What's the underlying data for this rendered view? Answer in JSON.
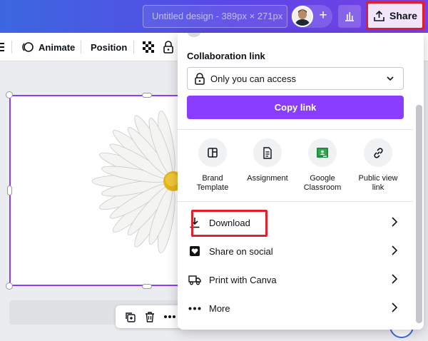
{
  "header": {
    "design_title": "Untitled design - 389px × 271px",
    "add_collaborator_symbol": "+",
    "share_label": "Share",
    "stats_icon": "bar-chart-icon",
    "share_icon": "upload-icon"
  },
  "toolbar": {
    "animate_label": "Animate",
    "position_label": "Position"
  },
  "share_panel": {
    "collaboration_label": "Collaboration link",
    "access_value": "Only you can access",
    "copy_link_label": "Copy link",
    "options": [
      {
        "label": "Brand Template",
        "icon": "brand-template-icon"
      },
      {
        "label": "Assignment",
        "icon": "document-icon"
      },
      {
        "label": "Google Classroom",
        "icon": "google-classroom-icon"
      },
      {
        "label": "Public view link",
        "icon": "link-icon"
      }
    ],
    "menu": [
      {
        "label": "Download",
        "icon": "download-icon"
      },
      {
        "label": "Share on social",
        "icon": "heart-icon"
      },
      {
        "label": "Print with Canva",
        "icon": "truck-icon"
      },
      {
        "label": "More",
        "icon": "more-icon"
      }
    ]
  },
  "colors": {
    "accent": "#8b3dff",
    "highlight": "#e0202a"
  }
}
